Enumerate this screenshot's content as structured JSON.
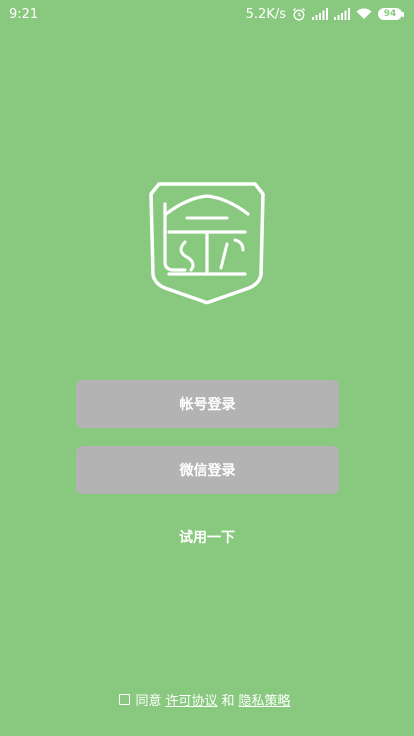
{
  "status_bar": {
    "time": "9:21",
    "net_speed": "5.2K/s",
    "battery": "94",
    "icons": [
      "alarm-icon",
      "signal-icon",
      "signal-icon",
      "wifi-icon",
      "battery-icon"
    ]
  },
  "logo": {
    "icon": "shield-logo-icon"
  },
  "buttons": {
    "account_login": "帐号登录",
    "wechat_login": "微信登录"
  },
  "trial": {
    "label": "试用一下"
  },
  "agreement": {
    "prefix": "同意",
    "license": "许可协议",
    "and": "和",
    "privacy": "隐私策略"
  },
  "colors": {
    "background": "#89c97f",
    "button": "#b3b3b3",
    "text": "#ffffff"
  }
}
